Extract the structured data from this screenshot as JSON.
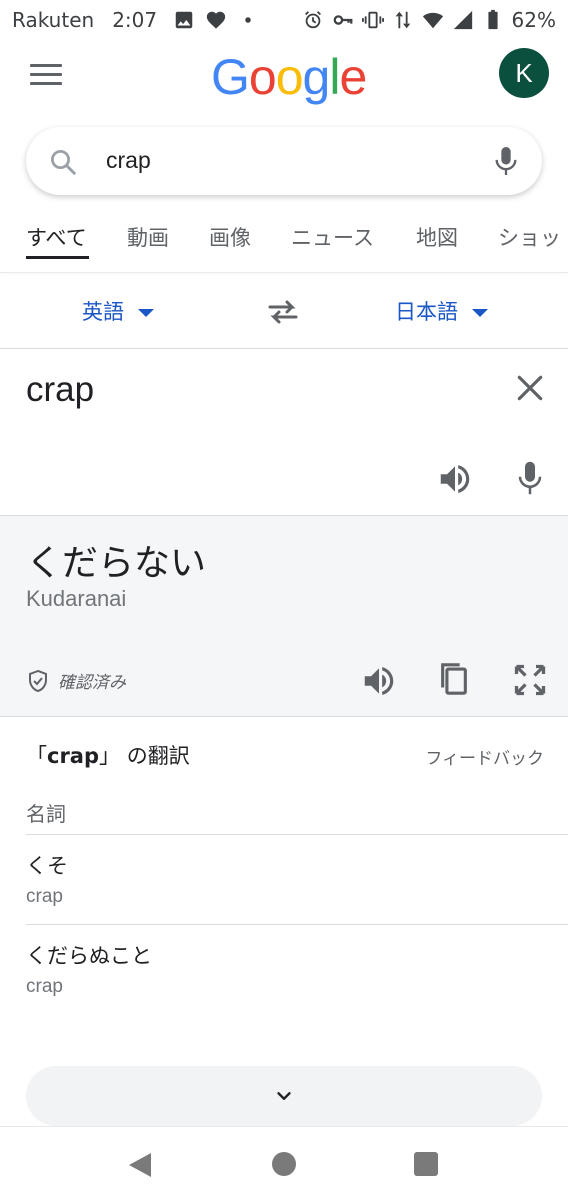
{
  "status_bar": {
    "carrier": "Rakuten",
    "time": "2:07",
    "battery": "62%"
  },
  "header": {
    "logo": [
      "G",
      "o",
      "o",
      "g",
      "l",
      "e"
    ],
    "avatar_letter": "K"
  },
  "search": {
    "query": "crap"
  },
  "tabs": [
    {
      "label": "すべて"
    },
    {
      "label": "動画"
    },
    {
      "label": "画像"
    },
    {
      "label": "ニュース"
    },
    {
      "label": "地図"
    },
    {
      "label": "ショッ"
    }
  ],
  "translator": {
    "source_lang": "英語",
    "target_lang": "日本語",
    "source_text": "crap",
    "result_text": "くだらない",
    "romanization": "Kudaranai",
    "verified_label": "確認済み"
  },
  "translations": {
    "title_prefix": "「",
    "title_word": "crap",
    "title_suffix": "」 の翻訳",
    "feedback": "フィードバック",
    "part_of_speech": "名詞",
    "entries": [
      {
        "word": "くそ",
        "reverse": "crap"
      },
      {
        "word": "くだらぬこと",
        "reverse": "crap"
      }
    ]
  },
  "colors": {
    "accent_blue": "#1a56c6",
    "avatar_bg": "#0b4f3f",
    "result_bg": "#f5f6f8"
  }
}
